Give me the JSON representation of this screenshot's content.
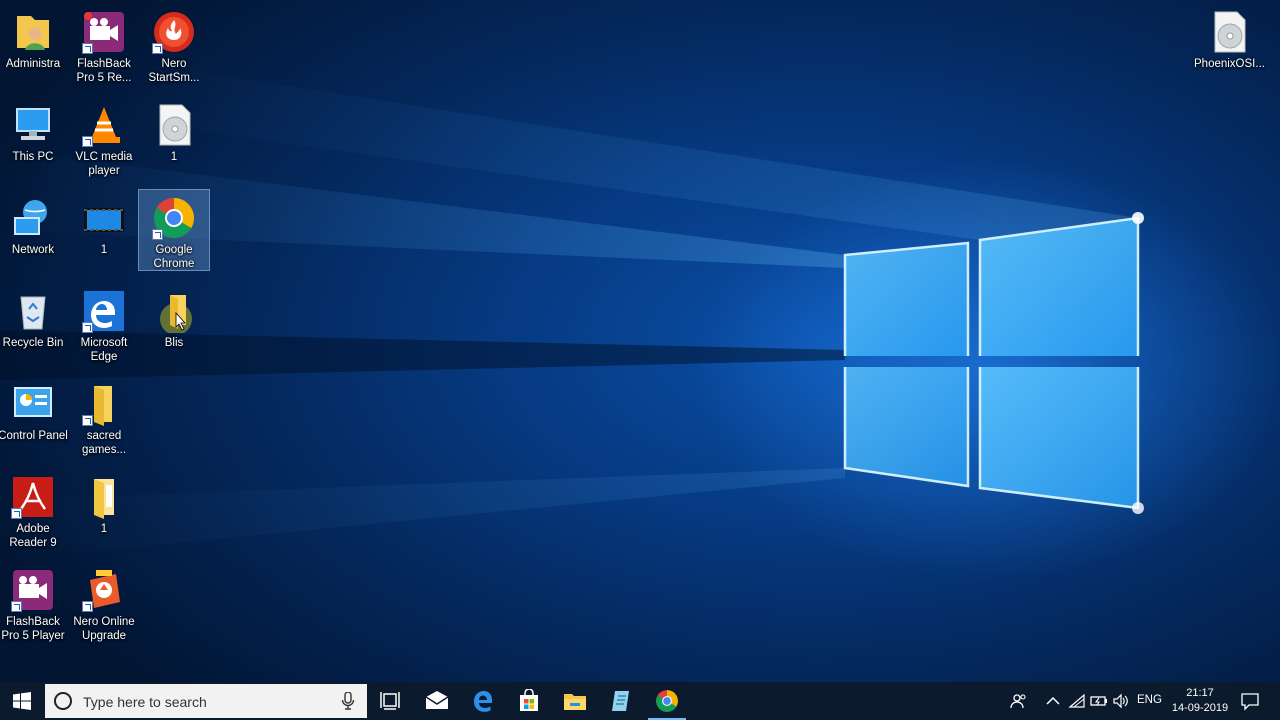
{
  "desktop": {
    "icons": [
      {
        "label": "Administra",
        "icon": "user-folder-icon"
      },
      {
        "label": "This PC",
        "icon": "computer-icon"
      },
      {
        "label": "Network",
        "icon": "network-icon"
      },
      {
        "label": "Recycle Bin",
        "icon": "recycle-bin-icon"
      },
      {
        "label": "Control Panel",
        "icon": "control-panel-icon"
      },
      {
        "label": "Adobe Reader 9",
        "icon": "adobe-reader-icon"
      },
      {
        "label": "FlashBack Pro 5 Player",
        "icon": "flashback-player-icon"
      },
      {
        "label": "FlashBack Pro 5 Re...",
        "icon": "flashback-recorder-icon"
      },
      {
        "label": "VLC media player",
        "icon": "vlc-icon"
      },
      {
        "label": "1",
        "icon": "video-file-icon"
      },
      {
        "label": "Microsoft Edge",
        "icon": "edge-icon"
      },
      {
        "label": "sacred games...",
        "icon": "folder-icon"
      },
      {
        "label": "1",
        "icon": "document-folder-icon"
      },
      {
        "label": "Nero Online Upgrade",
        "icon": "nero-upgrade-icon"
      },
      {
        "label": "Nero StartSm...",
        "icon": "nero-icon"
      },
      {
        "label": "1",
        "icon": "disc-image-icon"
      },
      {
        "label": "Google Chrome",
        "icon": "chrome-icon"
      },
      {
        "label": "Blis",
        "icon": "folder-icon"
      },
      {
        "label": "PhoenixOSI...",
        "icon": "disc-image-icon"
      }
    ]
  },
  "taskbar": {
    "search_placeholder": "Type here to search",
    "pinned": [
      "task-view-icon",
      "mail-icon",
      "edge-icon",
      "store-icon",
      "file-explorer-icon",
      "notepad-icon",
      "chrome-icon"
    ],
    "tray": {
      "language": "ENG",
      "time": "21:17",
      "date": "14-09-2019"
    }
  },
  "colors": {
    "taskbar_bg": "#0b1a2c",
    "wallpaper_glow": "#2a8cff",
    "selection": "#78aae6"
  }
}
